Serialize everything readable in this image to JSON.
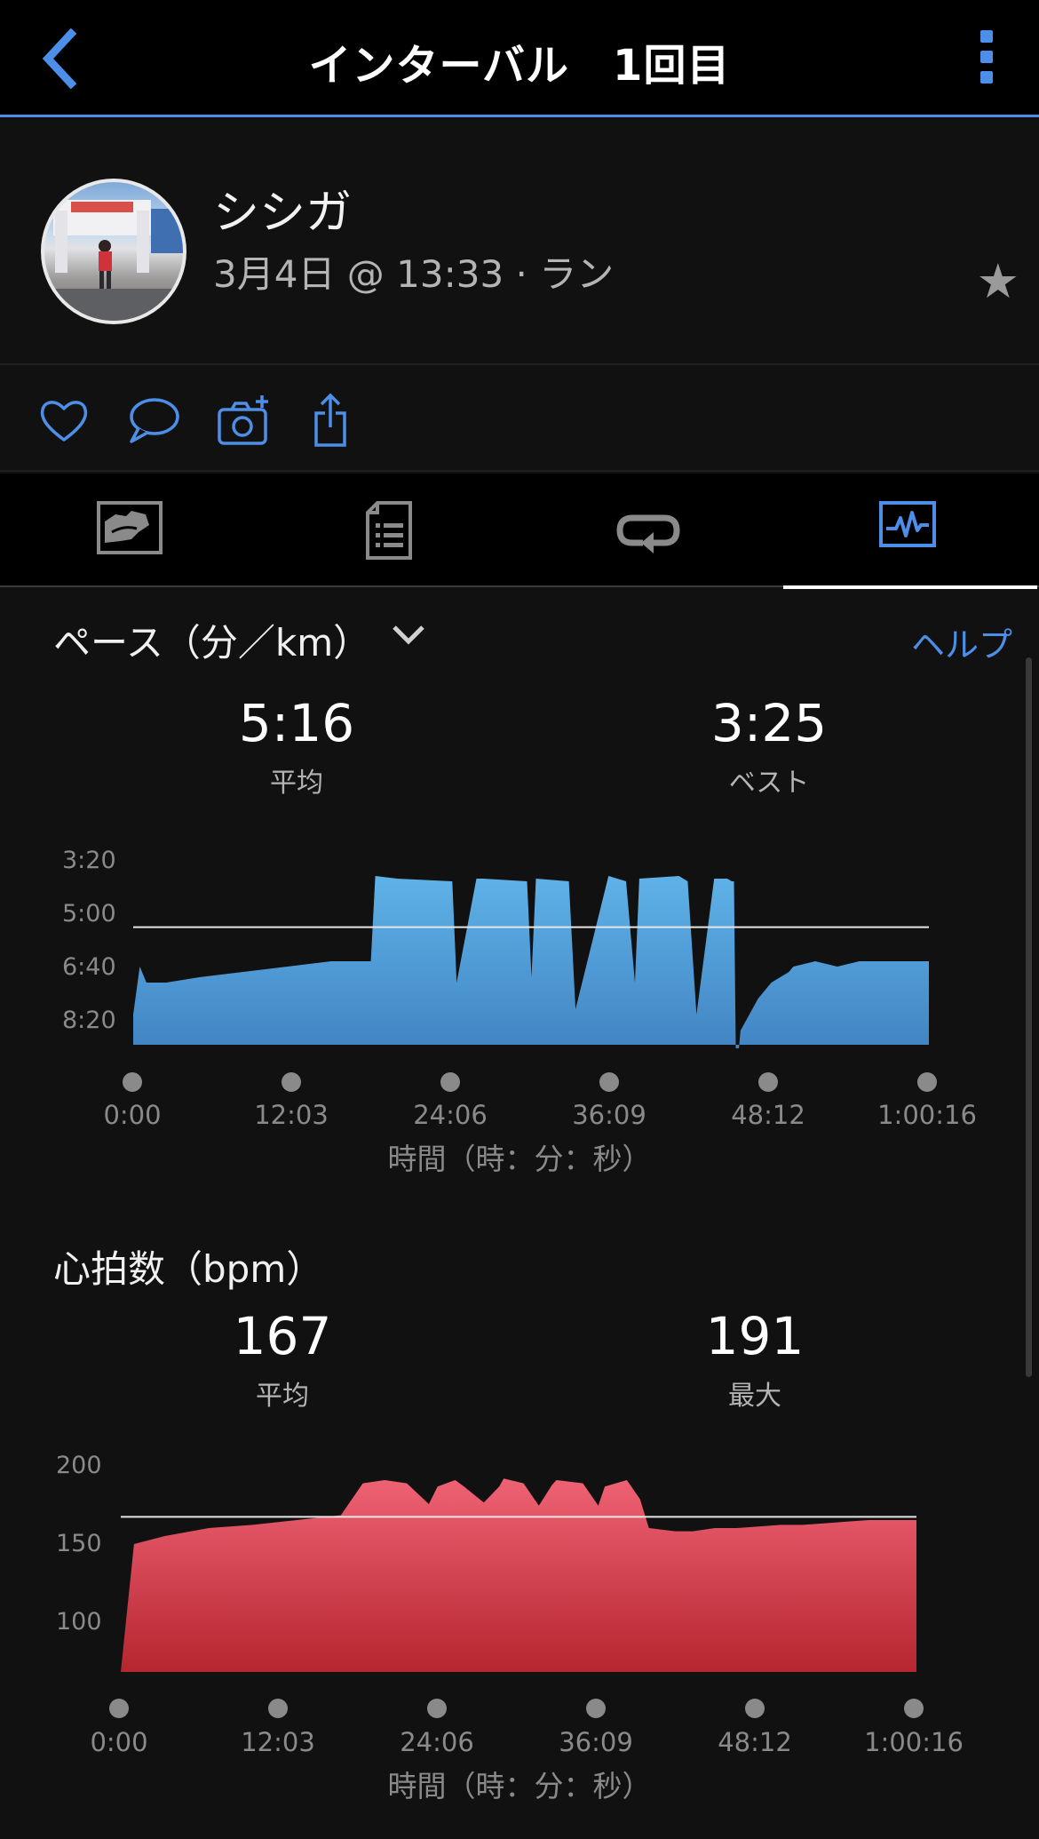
{
  "header": {
    "title": "インターバル　1回目"
  },
  "profile": {
    "name": "シシガ",
    "subtitle": "3月4日 @ 13:33 · ラン"
  },
  "colors": {
    "accent": "#4d8fe8",
    "pace": "#5fa9e0",
    "heart": "#e05364"
  },
  "tabs": [
    {
      "icon": "map-icon",
      "active": false
    },
    {
      "icon": "details-icon",
      "active": false
    },
    {
      "icon": "laps-icon",
      "active": false
    },
    {
      "icon": "charts-icon",
      "active": true
    }
  ],
  "pace_section": {
    "title": "ペース（分／km）",
    "help": "ヘルプ",
    "avg_value": "5:16",
    "avg_label": "平均",
    "best_value": "3:25",
    "best_label": "ベスト",
    "y_ticks": [
      "3:20",
      "5:00",
      "6:40",
      "8:20"
    ],
    "x_ticks": [
      "0:00",
      "12:03",
      "24:06",
      "36:09",
      "48:12",
      "1:00:16"
    ],
    "x_title": "時間（時：分：秒）"
  },
  "hr_section": {
    "title": "心拍数（bpm）",
    "avg_value": "167",
    "avg_label": "平均",
    "max_value": "191",
    "max_label": "最大",
    "y_ticks": [
      "200",
      "150",
      "100"
    ],
    "x_ticks": [
      "0:00",
      "12:03",
      "24:06",
      "36:09",
      "48:12",
      "1:00:16"
    ],
    "x_title": "時間（時：分：秒）"
  },
  "chart_data": [
    {
      "type": "area",
      "title": "ペース（分／km）",
      "xlabel": "時間（時：分：秒）",
      "ylabel": "ペース（分／km）",
      "x_unit": "seconds",
      "y_unit": "seconds per km",
      "y_inverted": true,
      "yticks": [
        "3:20",
        "5:00",
        "6:40",
        "8:20"
      ],
      "average_line": 316,
      "series": [
        {
          "x": [
            0,
            30,
            60,
            150,
            300,
            600,
            900,
            1080,
            1100,
            1200,
            1450,
            1470,
            1560,
            1590,
            1790,
            1810,
            1830,
            1980,
            2010,
            2160,
            2200,
            2240,
            2280,
            2300,
            2480,
            2520,
            2560,
            2640,
            2700,
            2720,
            2730,
            2740,
            2760,
            2800,
            2840,
            2900,
            2980,
            3000,
            3100,
            3200,
            3300,
            3400,
            3500,
            3616
          ],
          "values": [
            480,
            390,
            420,
            420,
            410,
            395,
            380,
            380,
            220,
            225,
            230,
            420,
            225,
            225,
            230,
            410,
            225,
            230,
            470,
            220,
            225,
            230,
            420,
            225,
            220,
            230,
            480,
            225,
            225,
            230,
            230,
            600,
            510,
            480,
            450,
            420,
            400,
            390,
            380,
            390,
            380,
            380,
            380,
            380
          ]
        }
      ]
    },
    {
      "type": "area",
      "title": "心拍数（bpm）",
      "xlabel": "時間（時：分：秒）",
      "ylabel": "心拍数（bpm）",
      "x_unit": "seconds",
      "ylim": [
        70,
        200
      ],
      "yticks": [
        200,
        150,
        100
      ],
      "average_line": 167,
      "series": [
        {
          "x": [
            0,
            60,
            200,
            400,
            600,
            800,
            1000,
            1100,
            1200,
            1300,
            1400,
            1440,
            1520,
            1560,
            1650,
            1720,
            1740,
            1830,
            1900,
            1960,
            1980,
            2100,
            2170,
            2200,
            2300,
            2360,
            2400,
            2520,
            2600,
            2700,
            2800,
            2900,
            3000,
            3100,
            3200,
            3300,
            3400,
            3500,
            3616
          ],
          "values": [
            70,
            150,
            155,
            160,
            162,
            165,
            168,
            188,
            190,
            188,
            175,
            186,
            190,
            186,
            176,
            186,
            191,
            188,
            174,
            187,
            190,
            188,
            174,
            186,
            190,
            178,
            160,
            158,
            158,
            160,
            160,
            161,
            162,
            162,
            163,
            164,
            165,
            165,
            165
          ]
        }
      ]
    }
  ]
}
